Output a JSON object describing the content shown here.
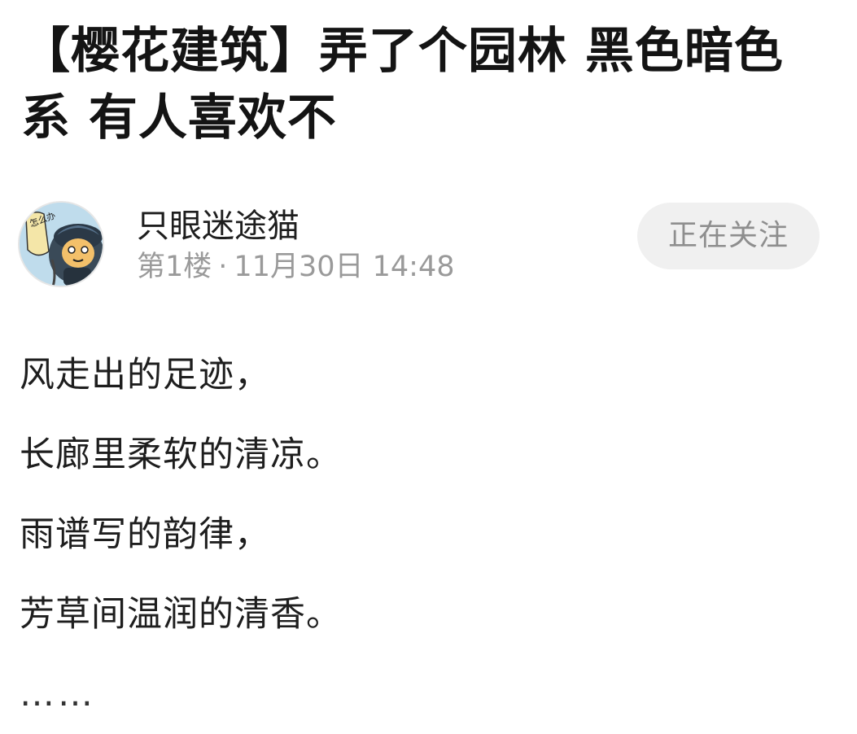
{
  "post": {
    "title": "【樱花建筑】弄了个园林 黑色暗色系 有人喜欢不",
    "author": {
      "name": "只眼迷途猫",
      "avatar_icon": "cartoon-cat-avatar",
      "avatar_text": "怎么办",
      "floor": "第1楼",
      "separator": "·",
      "date": "11月30日 14:48"
    },
    "follow_label": "正在关注",
    "body_lines": [
      "风走出的足迹，",
      "长廊里柔软的清凉。",
      "雨谱写的韵律，",
      "芳草间温润的清香。",
      "……"
    ]
  },
  "colors": {
    "title": "#141414",
    "meta_gray": "#9a9a9a",
    "follow_bg": "#f0f0f0",
    "follow_text": "#8e8e8e"
  }
}
